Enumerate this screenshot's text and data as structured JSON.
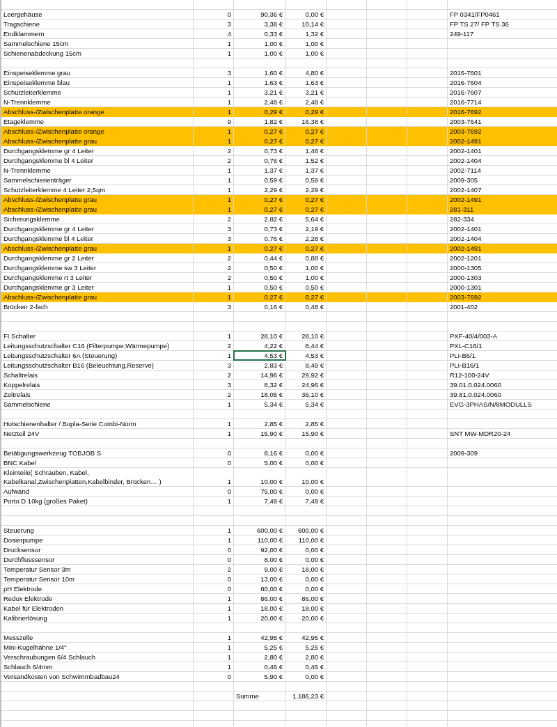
{
  "sheet": {
    "rows": [
      {
        "kind": "blank"
      },
      {
        "kind": "item",
        "name": "Leergehäuse",
        "qty": "0",
        "price": "90,36 €",
        "total": "0,00 €",
        "article": "FP 0341/FP0461",
        "highlighted": false,
        "selected": false
      },
      {
        "kind": "item",
        "name": "Tragschiene",
        "qty": "3",
        "price": "3,38 €",
        "total": "10,14 €",
        "article": "FP TS 27/ FP TS 36",
        "highlighted": false,
        "selected": false
      },
      {
        "kind": "item",
        "name": "Endklammern",
        "qty": "4",
        "price": "0,33 €",
        "total": "1,32 €",
        "article": "249-117",
        "highlighted": false,
        "selected": false
      },
      {
        "kind": "item",
        "name": "Sammelschiene 15cm",
        "qty": "1",
        "price": "1,00 €",
        "total": "1,00 €",
        "highlighted": false,
        "selected": false
      },
      {
        "kind": "item",
        "name": "Schienenabdeckung 15cm",
        "qty": "1",
        "price": "1,00 €",
        "total": "1,00 €",
        "highlighted": false,
        "selected": false
      },
      {
        "kind": "blank"
      },
      {
        "kind": "item",
        "name": "Einspeiseklemme grau",
        "qty": "3",
        "price": "1,60 €",
        "total": "4,80 €",
        "article": "2016-7601",
        "highlighted": false,
        "selected": false
      },
      {
        "kind": "item",
        "name": "Einspeiseklemme blau",
        "qty": "1",
        "price": "1,63 €",
        "total": "1,63 €",
        "article": "2016-7604",
        "highlighted": false,
        "selected": false
      },
      {
        "kind": "item",
        "name": "Schutzleiterklemme",
        "qty": "1",
        "price": "3,21 €",
        "total": "3,21 €",
        "article": "2016-7607",
        "highlighted": false,
        "selected": false
      },
      {
        "kind": "item",
        "name": "N-Trennklemme",
        "qty": "1",
        "price": "2,48 €",
        "total": "2,48 €",
        "article": "2016-7714",
        "highlighted": false,
        "selected": false
      },
      {
        "kind": "item",
        "name": "Abschluss-/Zwischenplatte orange",
        "qty": "1",
        "price": "0,29 €",
        "total": "0,29 €",
        "article": "2016-7692",
        "highlighted": true,
        "selected": false
      },
      {
        "kind": "item",
        "name": "Etageklemme",
        "qty": "9",
        "price": "1,82 €",
        "total": "16,38 €",
        "article": "2003-7641",
        "highlighted": false,
        "selected": false
      },
      {
        "kind": "item",
        "name": "Abschluss-/Zwischenplatte orange",
        "qty": "1",
        "price": "0,27 €",
        "total": "0,27 €",
        "article": "2003-7692",
        "highlighted": true,
        "selected": false
      },
      {
        "kind": "item",
        "name": "Abschluss-/Zwischenplatte grau",
        "qty": "1",
        "price": "0,27 €",
        "total": "0,27 €",
        "article": "2002-1491",
        "highlighted": true,
        "selected": false
      },
      {
        "kind": "item",
        "name": "Durchgangsklemme gr 4 Leiter",
        "qty": "2",
        "price": "0,73 €",
        "total": "1,46 €",
        "article": "2002-1401",
        "highlighted": false,
        "selected": false
      },
      {
        "kind": "item",
        "name": "Durchgangsklemme bl 4 Leiter",
        "qty": "2",
        "price": "0,76 €",
        "total": "1,52 €",
        "article": "2002-1404",
        "highlighted": false,
        "selected": false
      },
      {
        "kind": "item",
        "name": "N-Trennklemme",
        "qty": "1",
        "price": "1,37 €",
        "total": "1,37 €",
        "article": "2002-7114",
        "highlighted": false,
        "selected": false
      },
      {
        "kind": "item",
        "name": "Sammelschienenträger",
        "qty": "1",
        "price": "0,59 €",
        "total": "0,59 €",
        "article": "2009-305",
        "highlighted": false,
        "selected": false
      },
      {
        "kind": "item",
        "name": "Schutzleiterklemme 4 Leiter 2,5qm",
        "qty": "1",
        "price": "2,29 €",
        "total": "2,29 €",
        "article": "2002-1407",
        "highlighted": false,
        "selected": false
      },
      {
        "kind": "item",
        "name": "Abschluss-/Zwischenplatte grau",
        "qty": "1",
        "price": "0,27 €",
        "total": "0,27 €",
        "article": "2002-1491",
        "highlighted": true,
        "selected": false
      },
      {
        "kind": "item",
        "name": "Abschluss-/Zwischenplatte grau",
        "qty": "1",
        "price": "0,27 €",
        "total": "0,27 €",
        "article": "281-311",
        "highlighted": true,
        "selected": false
      },
      {
        "kind": "item",
        "name": "Sicherungsklemme",
        "qty": "2",
        "price": "2,82 €",
        "total": "5,64 €",
        "article": "282-334",
        "highlighted": false,
        "selected": false
      },
      {
        "kind": "item",
        "name": "Durchgangsklemme gr 4 Leiter",
        "qty": "3",
        "price": "0,73 €",
        "total": "2,19 €",
        "article": "2002-1401",
        "highlighted": false,
        "selected": false
      },
      {
        "kind": "item",
        "name": "Durchgangsklemme bl 4 Leiter",
        "qty": "3",
        "price": "0,76 €",
        "total": "2,28 €",
        "article": "2002-1404",
        "highlighted": false,
        "selected": false
      },
      {
        "kind": "item",
        "name": "Abschluss-/Zwischenplatte grau",
        "qty": "1",
        "price": "0,27 €",
        "total": "0,27 €",
        "article": "2002-1491",
        "highlighted": true,
        "selected": false
      },
      {
        "kind": "item",
        "name": "Durchgangsklemme gr 2 Leiter",
        "qty": "2",
        "price": "0,44 €",
        "total": "0,88 €",
        "article": "2002-1201",
        "highlighted": false,
        "selected": false
      },
      {
        "kind": "item",
        "name": "Durchgangsklemme sw 3 Leiter",
        "qty": "2",
        "price": "0,50 €",
        "total": "1,00 €",
        "article": "2000-1305",
        "highlighted": false,
        "selected": false
      },
      {
        "kind": "item",
        "name": "Durchgangsklemme rt 3 Leiter",
        "qty": "2",
        "price": "0,50 €",
        "total": "1,00 €",
        "article": "2000-1303",
        "highlighted": false,
        "selected": false
      },
      {
        "kind": "item",
        "name": "Durchgangsklemme gr 3 Leiter",
        "qty": "1",
        "price": "0,50 €",
        "total": "0,50 €",
        "article": "2000-1301",
        "highlighted": false,
        "selected": false
      },
      {
        "kind": "item",
        "name": "Abschluss-/Zwischenplatte grau",
        "qty": "1",
        "price": "0,27 €",
        "total": "0,27 €",
        "article": "2003-7692",
        "highlighted": true,
        "selected": false
      },
      {
        "kind": "item",
        "name": "Brücken 2-fach",
        "qty": "3",
        "price": "0,16 €",
        "total": "0,48 €",
        "article": "2001-402",
        "highlighted": false,
        "selected": false
      },
      {
        "kind": "blank"
      },
      {
        "kind": "blank"
      },
      {
        "kind": "item",
        "name": "FI Schalter",
        "qty": "1",
        "price": "28,10 €",
        "total": "28,10 €",
        "article": "PXF-40/4/003-A",
        "highlighted": false,
        "selected": false
      },
      {
        "kind": "item",
        "name": "Leitungsschutzschalter C16 (Filterpumpe,Wärmepumpe)",
        "qty": "2",
        "price": "4,22 €",
        "total": "8,44 €",
        "article": "PXL-C16/1",
        "highlighted": false,
        "selected": false
      },
      {
        "kind": "item",
        "name": "Leitungsschutzschalter 6A (Steuerung)",
        "qty": "1",
        "price": "4,53 €",
        "total": "4,53 €",
        "article": "PLI-B6/1",
        "highlighted": false,
        "selected": true
      },
      {
        "kind": "item",
        "name": "Leitungsschutzschalter B16 (Beleuchtung,Reserve)",
        "qty": "3",
        "price": "2,83 €",
        "total": "8,49 €",
        "article": "PLI-B16/1",
        "highlighted": false,
        "selected": false
      },
      {
        "kind": "item",
        "name": "Schaltrelais",
        "qty": "2",
        "price": "14,96 €",
        "total": "29,92 €",
        "article": "R12-100-24V",
        "highlighted": false,
        "selected": false
      },
      {
        "kind": "item",
        "name": "Koppelrelais",
        "qty": "3",
        "price": "8,32 €",
        "total": "24,96 €",
        "article": "39.01.0.024.0060",
        "highlighted": false,
        "selected": false
      },
      {
        "kind": "item",
        "name": "Zeitrelais",
        "qty": "2",
        "price": "18,05 €",
        "total": "36,10 €",
        "article": "39.81.0.024.0060",
        "highlighted": false,
        "selected": false
      },
      {
        "kind": "item",
        "name": "Sammelschiene",
        "qty": "1",
        "price": "5,34 €",
        "total": "5,34 €",
        "article": "EVG-3PHAS/N/8MODULLS",
        "highlighted": false,
        "selected": false
      },
      {
        "kind": "blank"
      },
      {
        "kind": "item",
        "name": "Hutschienenhalter / Bopla-Serie Combi-Norm",
        "qty": "1",
        "price": "2,85 €",
        "total": "2,85 €",
        "highlighted": false,
        "selected": false
      },
      {
        "kind": "item",
        "name": "Netzteil 24V",
        "qty": "1",
        "price": "15,90 €",
        "total": "15,90 €",
        "article": "SNT MW-MDR20-24",
        "highlighted": false,
        "selected": false
      },
      {
        "kind": "blank"
      },
      {
        "kind": "item",
        "name": "Betätigungswerkzeug TOBJOB S",
        "qty": "0",
        "price": "8,16 €",
        "total": "0,00 €",
        "article": "2009-309",
        "highlighted": false,
        "selected": false
      },
      {
        "kind": "item",
        "name": "BNC Kabel",
        "qty": "0",
        "price": "5,00 €",
        "total": "0,00 €",
        "highlighted": false,
        "selected": false
      },
      {
        "kind": "item",
        "name": "Kleinteile( Schrauben, Kabel, Kabelkanal,Zwischenplatten,Kabelbinder, Brücken… )",
        "qty": "1",
        "price": "10,00 €",
        "total": "10,00 €",
        "highlighted": false,
        "selected": false
      },
      {
        "kind": "item",
        "name": "Aufwand",
        "qty": "0",
        "price": "75,00 €",
        "total": "0,00 €",
        "highlighted": false,
        "selected": false
      },
      {
        "kind": "item",
        "name": "Porto D 10kg (großes Paket)",
        "qty": "1",
        "price": "7,49 €",
        "total": "7,49 €",
        "highlighted": false,
        "selected": false
      },
      {
        "kind": "blank"
      },
      {
        "kind": "blank"
      },
      {
        "kind": "item",
        "name": "Steuerung",
        "qty": "1",
        "price": "600,00 €",
        "total": "600,00 €",
        "highlighted": false,
        "selected": false
      },
      {
        "kind": "item",
        "name": "Dosierpumpe",
        "qty": "1",
        "price": "110,00 €",
        "total": "110,00 €",
        "highlighted": false,
        "selected": false
      },
      {
        "kind": "item",
        "name": "Drucksensor",
        "qty": "0",
        "price": "92,00 €",
        "total": "0,00 €",
        "highlighted": false,
        "selected": false
      },
      {
        "kind": "item",
        "name": "Durchflusssensor",
        "qty": "0",
        "price": "8,00 €",
        "total": "0,00 €",
        "highlighted": false,
        "selected": false
      },
      {
        "kind": "item",
        "name": "Temperatur Sensor 3m",
        "qty": "2",
        "price": "9,00 €",
        "total": "18,00 €",
        "highlighted": false,
        "selected": false
      },
      {
        "kind": "item",
        "name": "Temperatur Sensor 10m",
        "qty": "0",
        "price": "13,00 €",
        "total": "0,00 €",
        "highlighted": false,
        "selected": false
      },
      {
        "kind": "item",
        "name": "pH Elektrode",
        "qty": "0",
        "price": "80,00 €",
        "total": "0,00 €",
        "highlighted": false,
        "selected": false
      },
      {
        "kind": "item",
        "name": "Redox Elektrode",
        "qty": "1",
        "price": "86,00 €",
        "total": "86,00 €",
        "highlighted": false,
        "selected": false
      },
      {
        "kind": "item",
        "name": "Kabel für Elektroden",
        "qty": "1",
        "price": "18,00 €",
        "total": "18,00 €",
        "highlighted": false,
        "selected": false
      },
      {
        "kind": "item",
        "name": "Kalibrierlösung",
        "qty": "1",
        "price": "20,00 €",
        "total": "20,00 €",
        "highlighted": false,
        "selected": false
      },
      {
        "kind": "blank"
      },
      {
        "kind": "item",
        "name": "Messzelle",
        "qty": "1",
        "price": "42,95 €",
        "total": "42,95 €",
        "highlighted": false,
        "selected": false
      },
      {
        "kind": "item",
        "name": "Mini-Kugelhähne 1/4\"",
        "qty": "1",
        "price": "5,25 €",
        "total": "5,25 €",
        "highlighted": false,
        "selected": false
      },
      {
        "kind": "item",
        "name": "Verschraubungen 6/4 Schlauch",
        "qty": "1",
        "price": "2,80 €",
        "total": "2,80 €",
        "highlighted": false,
        "selected": false
      },
      {
        "kind": "item",
        "name": "Schlauch 6/4mm",
        "qty": "1",
        "price": "0,46 €",
        "total": "0,46 €",
        "highlighted": false,
        "selected": false
      },
      {
        "kind": "item",
        "name": "Versandkosten von Schwimmbadbau24",
        "qty": "0",
        "price": "5,90 €",
        "total": "0,00 €",
        "highlighted": false,
        "selected": false
      },
      {
        "kind": "blank"
      },
      {
        "kind": "sum",
        "label": "Summe",
        "total": "1.186,23 €"
      }
    ]
  }
}
